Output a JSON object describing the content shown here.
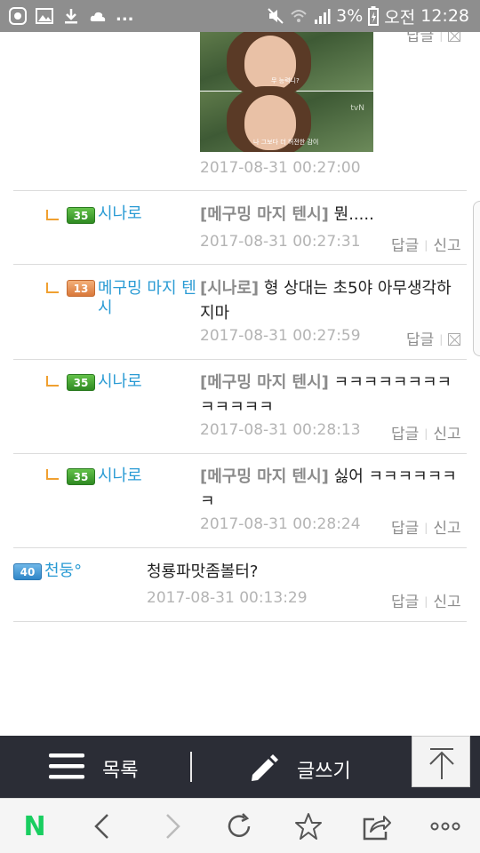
{
  "status_bar": {
    "battery": "3%",
    "ampm": "오전",
    "time": "12:28",
    "more": "..."
  },
  "post_photo": {
    "caption_top": "무 능력니?",
    "caption_bottom": "나 그보다 더 허전한 감이",
    "watermark": "tvN"
  },
  "first_comment_tail": {
    "timestamp": "2017-08-31 00:27:00",
    "reply_label": "답글"
  },
  "comments": [
    {
      "level": "35",
      "nick": "시나로",
      "mention": "[메구밍 마지 텐시]",
      "text": "뭔.....",
      "timestamp": "2017-08-31 00:27:31",
      "reply_label": "답글",
      "report_label": "신고"
    },
    {
      "level": "13",
      "nick_line1": "메구밍 마지 텐",
      "nick_line2": "시",
      "mention": "[시나로]",
      "text_line1": "형 상대는 초5야 아무생각하",
      "text_line2": "지마",
      "timestamp": "2017-08-31 00:27:59",
      "reply_label": "답글"
    },
    {
      "level": "35",
      "nick": "시나로",
      "mention": "[메구밍 마지 텐시]",
      "text_line1": "ㅋㅋㅋㅋㅋㅋㅋㅋ",
      "text_line2": "ㅋㅋㅋㅋㅋ",
      "timestamp": "2017-08-31 00:28:13",
      "reply_label": "답글",
      "report_label": "신고"
    },
    {
      "level": "35",
      "nick": "시나로",
      "mention": "[메구밍 마지 텐시]",
      "text_line1": "싫어 ㅋㅋㅋㅋㅋㅋ",
      "text_line2": "ㅋ",
      "timestamp": "2017-08-31 00:28:24",
      "reply_label": "답글",
      "report_label": "신고"
    },
    {
      "level": "40",
      "nick": "천둥°",
      "text": "청룡파맛좀볼터?",
      "timestamp": "2017-08-31 00:13:29",
      "reply_label": "답글",
      "report_label": "신고"
    }
  ],
  "app_bar": {
    "list_label": "목록",
    "write_label": "글쓰기"
  },
  "browser_bar": {
    "home_logo": "N"
  },
  "colors": {
    "nick": "#2a9bd4",
    "reply_arrow": "#f0a030",
    "app_bar_bg": "#2b2d36",
    "naver_green": "#19ce60"
  },
  "icons": [
    "app-icon",
    "image-icon",
    "download-icon",
    "cloud-icon",
    "mute-icon",
    "wifi-icon",
    "signal-icon",
    "battery-icon",
    "hamburger-icon",
    "pencil-icon",
    "scroll-top-icon",
    "back-icon",
    "forward-icon",
    "refresh-icon",
    "star-icon",
    "share-icon",
    "more-icon"
  ]
}
